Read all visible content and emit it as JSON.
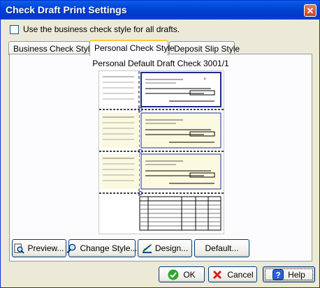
{
  "window": {
    "title": "Check Draft Print Settings",
    "close_icon": "close-icon"
  },
  "options": {
    "use_business_style_label": "Use the business check style for all drafts.",
    "use_business_style_checked": false
  },
  "tabs": [
    {
      "label": "Business Check Style",
      "active": false
    },
    {
      "label": "Personal Check Style",
      "active": true
    },
    {
      "label": "Deposit Slip Style",
      "active": false
    }
  ],
  "panel": {
    "title": "Personal Default Draft Check 3001/1"
  },
  "panel_buttons": {
    "preview": {
      "label": "Preview...",
      "icon": "magnifier-document-icon"
    },
    "change_style": {
      "label": "Change Style...",
      "icon": "magnifier-icon"
    },
    "design": {
      "label": "Design...",
      "icon": "design-ruler-icon"
    },
    "default": {
      "label": "Default..."
    }
  },
  "dialog_buttons": {
    "ok": {
      "label": "OK",
      "icon": "check-icon"
    },
    "cancel": {
      "label": "Cancel",
      "icon": "x-icon"
    },
    "help": {
      "label": "Help",
      "icon": "help-icon"
    }
  },
  "colors": {
    "title_bar": "#0044d4",
    "dialog_bg": "#ece9d8",
    "check_fill": "#fbf9e0",
    "check_border": "#1a2a8c"
  }
}
